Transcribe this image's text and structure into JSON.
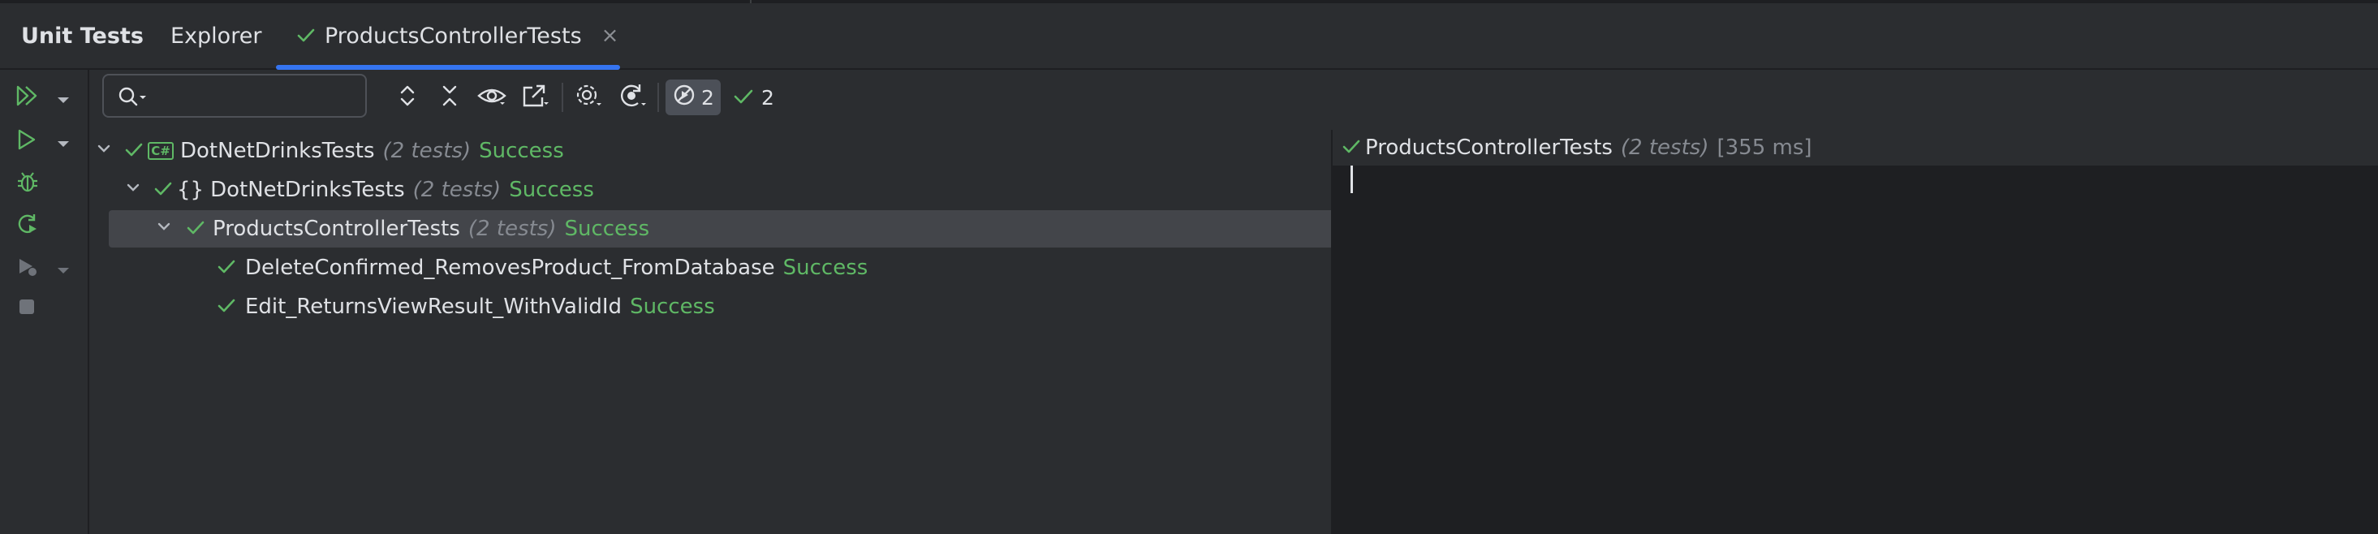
{
  "tabs": {
    "title": "Unit Tests",
    "explorer": "Explorer",
    "active": "ProductsControllerTests",
    "close_glyph": "×"
  },
  "left_toolbar": [
    {
      "name": "run-all-icon",
      "caret": true
    },
    {
      "name": "run-icon",
      "caret": true
    },
    {
      "name": "debug-icon",
      "caret": false
    },
    {
      "name": "rerun-icon",
      "caret": false
    },
    {
      "name": "profile-icon",
      "caret": true
    },
    {
      "name": "stop-icon",
      "caret": false
    }
  ],
  "toolbar": {
    "search_placeholder": "",
    "ignored_count": "2",
    "passed_count": "2"
  },
  "tree": [
    {
      "label": "DotNetDrinksTests",
      "count": "(2 tests)",
      "status": "Success",
      "badge": "C#"
    },
    {
      "label": "DotNetDrinksTests",
      "count": "(2 tests)",
      "status": "Success",
      "badge": "{}"
    },
    {
      "label": "ProductsControllerTests",
      "count": "(2 tests)",
      "status": "Success"
    },
    {
      "label": "DeleteConfirmed_RemovesProduct_FromDatabase",
      "status": "Success"
    },
    {
      "label": "Edit_ReturnsViewResult_WithValidId",
      "status": "Success"
    }
  ],
  "details": {
    "title": "ProductsControllerTests",
    "count": "(2 tests)",
    "duration": "[355 ms]"
  },
  "colors": {
    "success": "#5fb865",
    "accent": "#3574f0",
    "background": "#2b2d30",
    "output_background": "#1e1f22"
  }
}
